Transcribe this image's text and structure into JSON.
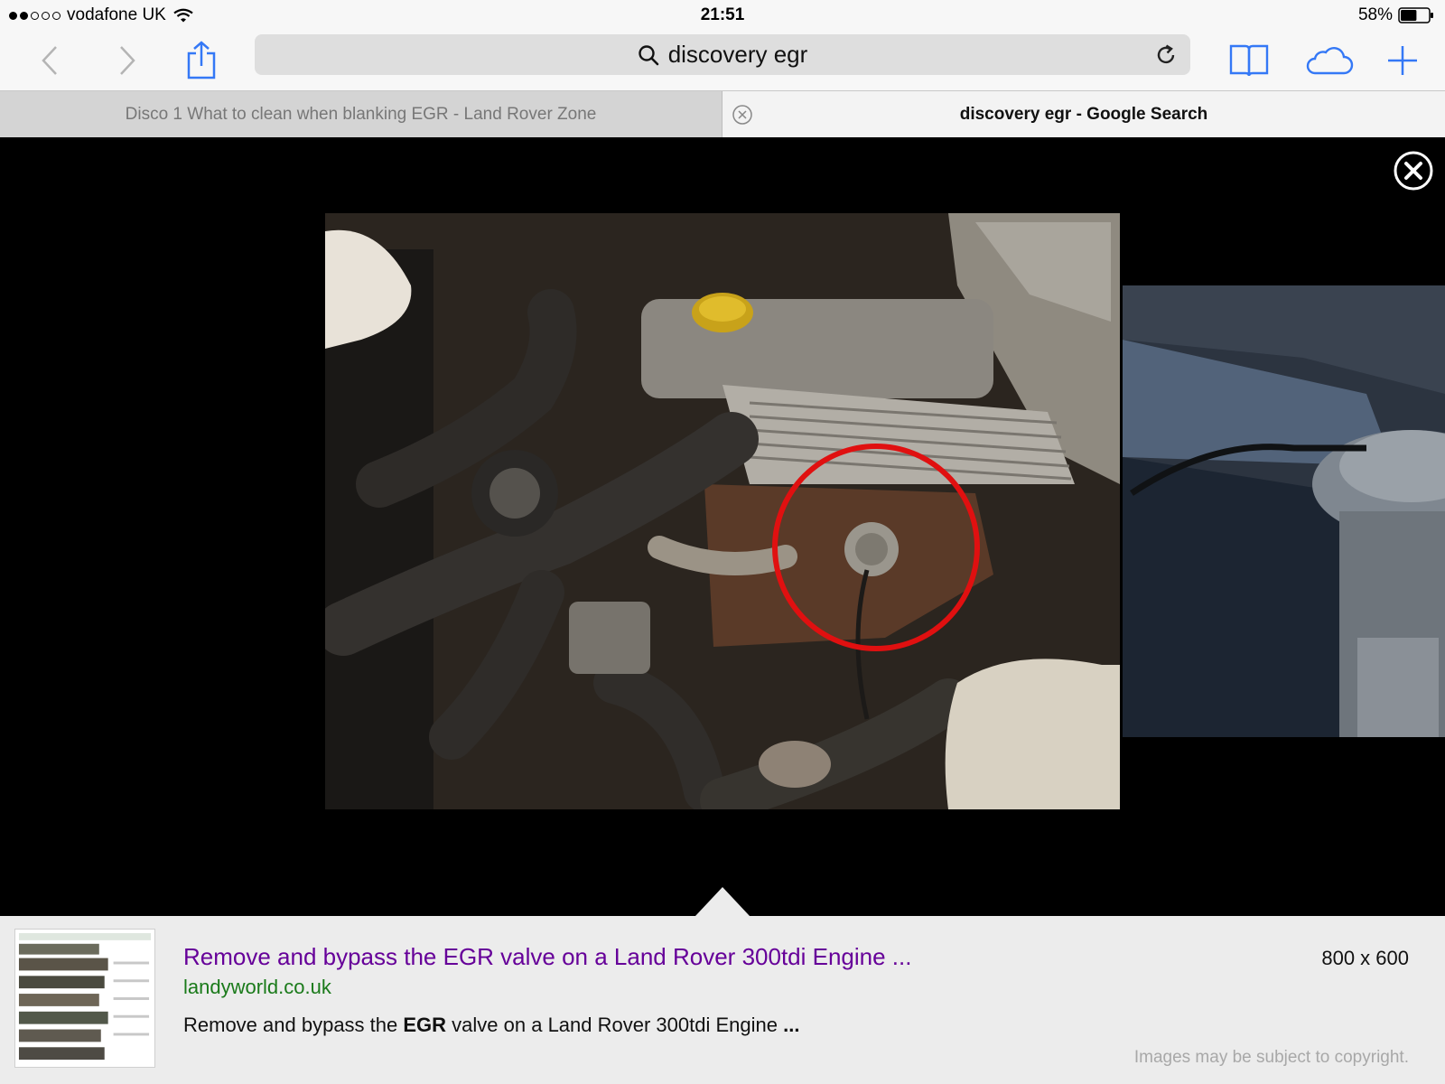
{
  "status": {
    "carrier": "vodafone UK",
    "time": "21:51",
    "battery": "58%",
    "battery_level": 0.58,
    "signal_bars_filled": 2,
    "signal_bars_total": 5
  },
  "toolbar": {
    "search_text": "discovery egr"
  },
  "tabs": [
    {
      "title": "Disco 1 What to clean when blanking EGR - Land Rover Zone",
      "active": false
    },
    {
      "title": "discovery egr - Google Search",
      "active": true
    }
  ],
  "result": {
    "title": "Remove and bypass the EGR valve on a Land Rover 300tdi Engine ...",
    "site": "landyworld.co.uk",
    "desc_before": "Remove and bypass the ",
    "desc_bold": "EGR",
    "desc_after": " valve on a Land Rover 300tdi Engine ",
    "desc_ellipsis": "...",
    "dimensions": "800 x 600",
    "copyright": "Images may be subject to copyright."
  },
  "colors": {
    "result_title": "#660099",
    "result_site": "#1a7a1a",
    "accent_blue": "#3478f6",
    "annotation_circle": "#e01010"
  }
}
